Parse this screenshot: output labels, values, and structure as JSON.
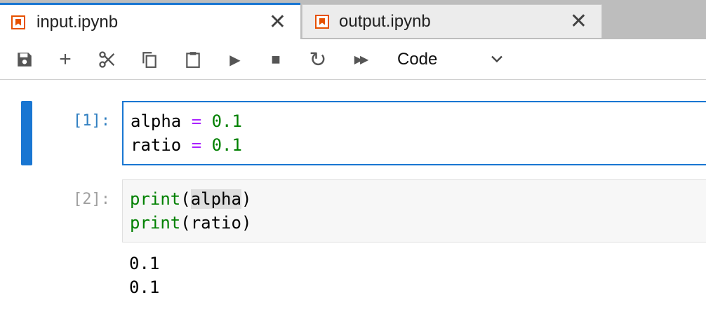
{
  "tabs": [
    {
      "label": "input.ipynb",
      "active": true,
      "close": "✕"
    },
    {
      "label": "output.ipynb",
      "active": false,
      "close": "✕"
    }
  ],
  "toolbar": {
    "buttons": [
      "save-icon",
      "add-icon",
      "cut-icon",
      "copy-icon",
      "paste-icon",
      "run-icon",
      "stop-icon",
      "restart-icon",
      "fast-forward-icon"
    ],
    "add_glyph": "+",
    "run_glyph": "▶",
    "stop_glyph": "■",
    "restart_glyph": "↻",
    "fast_forward_glyph": "▶▶",
    "cell_type": "Code"
  },
  "cells": [
    {
      "prompt": "[1]:",
      "active": true,
      "lines": [
        {
          "name": "alpha",
          "op": "=",
          "value": "0.1"
        },
        {
          "name": "ratio",
          "op": "=",
          "value": "0.1"
        }
      ]
    },
    {
      "prompt": "[2]:",
      "active": false,
      "lines": [
        {
          "fn": "print",
          "open": "(",
          "arg": "alpha",
          "close": ")"
        },
        {
          "fn": "print",
          "open": "(",
          "arg": "ratio",
          "close": ")"
        }
      ],
      "outputs": [
        "0.1",
        "0.1"
      ]
    }
  ],
  "colors": {
    "accent": "#1976d2",
    "tab_icon": "#e65100",
    "keyword_green": "#008000",
    "operator_purple": "#aa22ff"
  }
}
